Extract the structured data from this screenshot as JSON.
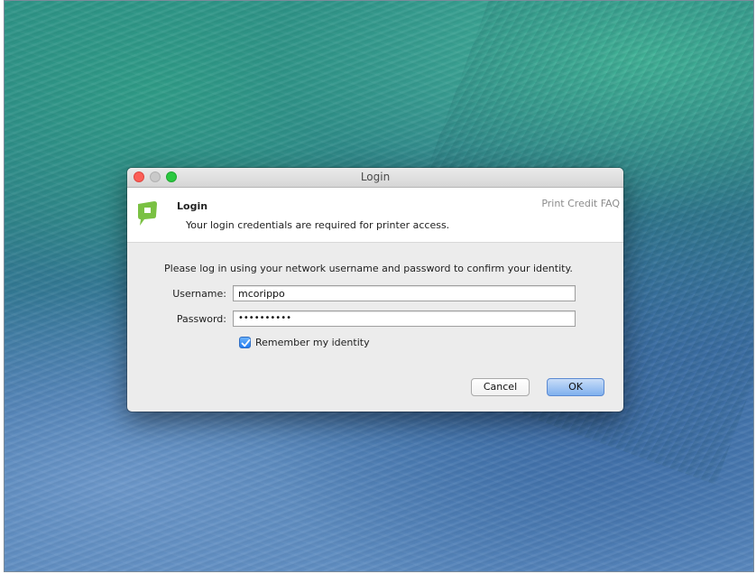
{
  "window": {
    "title": "Login"
  },
  "header": {
    "title": "Login",
    "subtitle": "Your login credentials are required for printer access.",
    "faq_link": "Print Credit FAQ"
  },
  "form": {
    "instructions": "Please log in using your network username and password to confirm your identity.",
    "username_label": "Username:",
    "username_value": "mcorippo",
    "password_label": "Password:",
    "password_mask": "••••••••••",
    "remember_label": "Remember my identity",
    "remember_checked": true
  },
  "buttons": {
    "cancel": "Cancel",
    "ok": "OK"
  },
  "colors": {
    "logo_green": "#7ac143",
    "ok_blue": "#7fb0ee",
    "checkbox_blue": "#1f7bf2"
  },
  "icons": {
    "logo": "papercut-logo-icon",
    "checkbox": "checkmark-icon"
  }
}
